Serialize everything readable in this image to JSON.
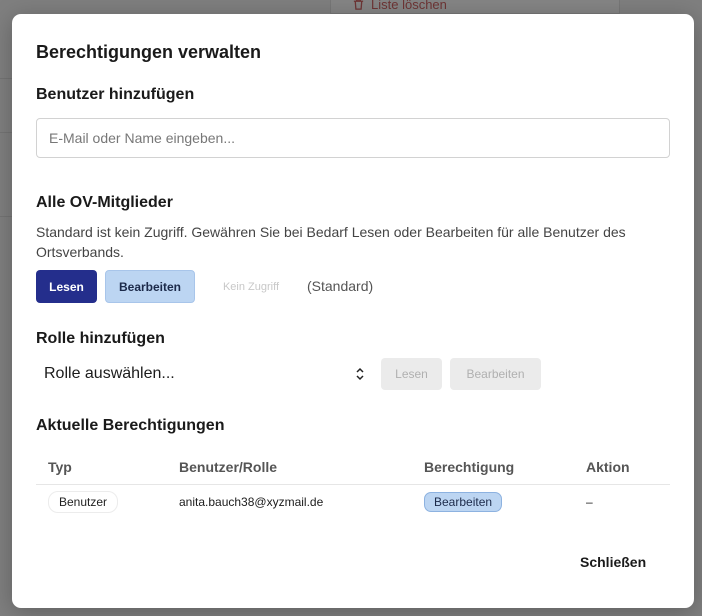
{
  "background": {
    "clear_list_label": "Liste löschen"
  },
  "modal": {
    "title": "Berechtigungen verwalten",
    "add_user": {
      "heading": "Benutzer hinzufügen",
      "placeholder": "E-Mail oder Name eingeben..."
    },
    "all_members": {
      "heading": "Alle OV-Mitglieder",
      "description": "Standard ist kein Zugriff. Gewähren Sie bei Bedarf Lesen oder Bearbeiten für alle Benutzer des Ortsverbands.",
      "read_label": "Lesen",
      "edit_label": "Bearbeiten",
      "no_access_label": "Kein Zugriff",
      "default_note": "(Standard)"
    },
    "add_role": {
      "heading": "Rolle hinzufügen",
      "select_value": "Rolle auswählen...",
      "read_label": "Lesen",
      "edit_label": "Bearbeiten"
    },
    "current": {
      "heading": "Aktuelle Berechtigungen",
      "columns": [
        "Typ",
        "Benutzer/Rolle",
        "Berechtigung",
        "Aktion"
      ],
      "rows": [
        {
          "type": "Benutzer",
          "subject": "anita.bauch38@xyzmail.de",
          "permission": "Bearbeiten",
          "action": "–"
        }
      ]
    },
    "close_label": "Schließen"
  },
  "colors": {
    "primary": "#242e8c",
    "light_button": "#bcd5f2",
    "overlay": "#808080"
  }
}
